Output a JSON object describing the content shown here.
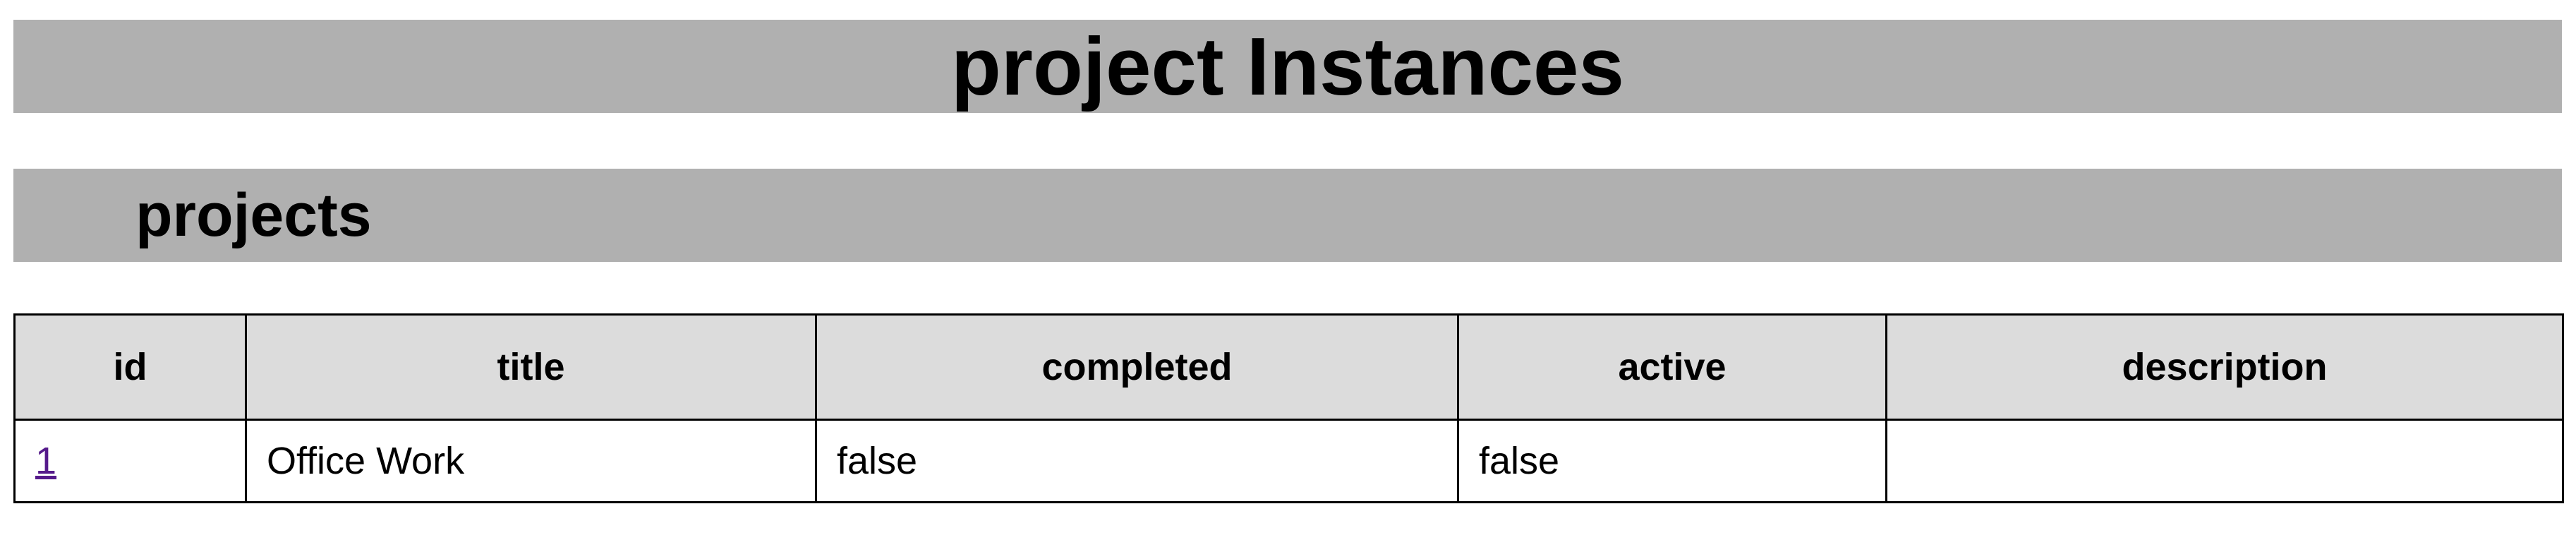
{
  "page": {
    "title": "project Instances",
    "section_title": "projects"
  },
  "table": {
    "columns": [
      "id",
      "title",
      "completed",
      "active",
      "description"
    ],
    "rows": [
      {
        "id": "1",
        "title": "Office Work",
        "completed": "false",
        "active": "false",
        "description": ""
      }
    ]
  },
  "colors": {
    "header_bar": "#b0b0b0",
    "table_header": "#dcdcdc",
    "link": "#551a8b"
  }
}
